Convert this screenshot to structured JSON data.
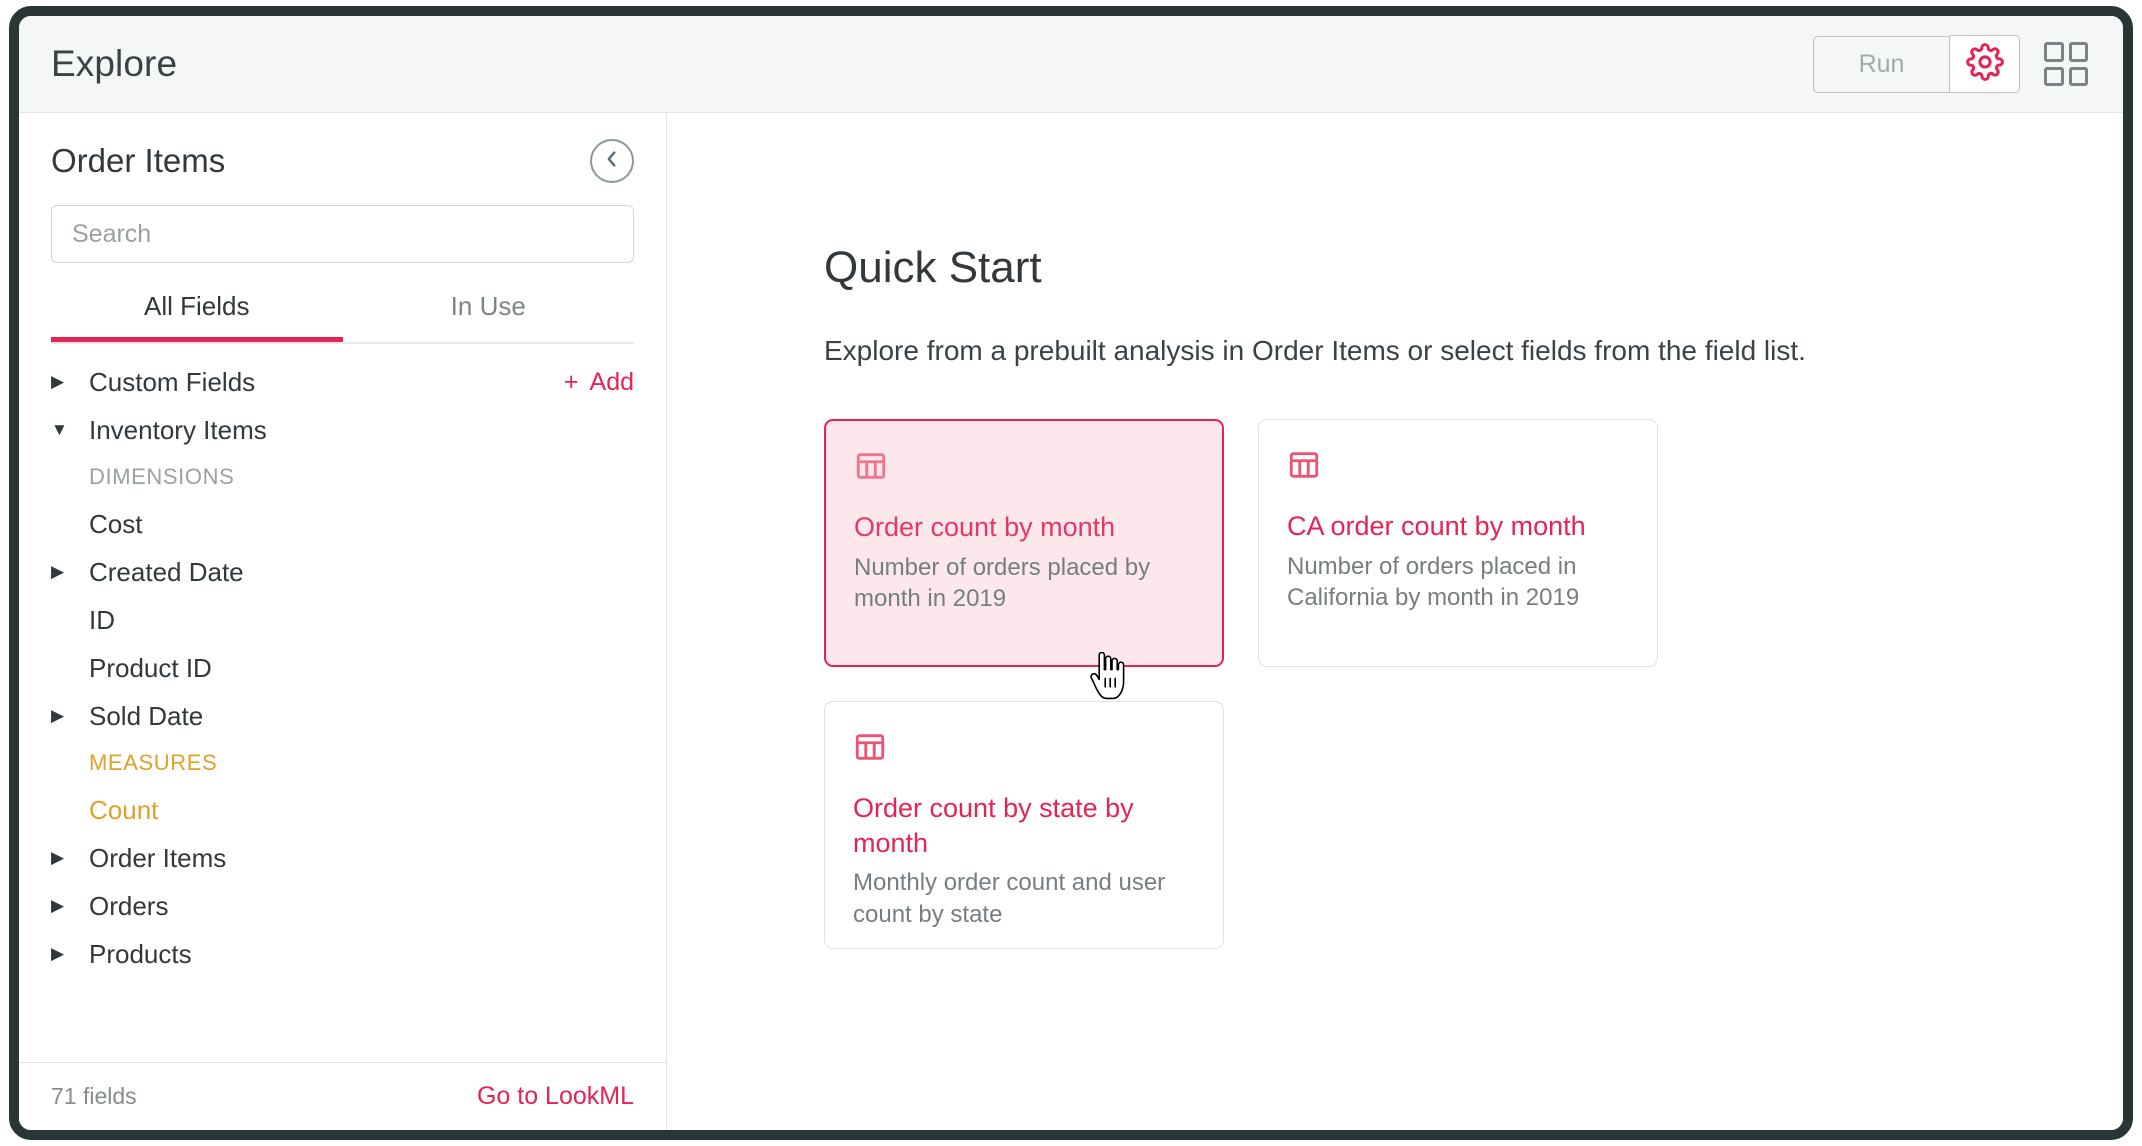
{
  "topbar": {
    "title": "Explore",
    "run_label": "Run",
    "gear_icon": "gear-icon",
    "apps_icon": "apps-grid-icon"
  },
  "sidebar": {
    "title": "Order Items",
    "collapse_icon": "chevron-left-icon",
    "search": {
      "value": "",
      "placeholder": "Search"
    },
    "tabs": [
      {
        "label": "All Fields",
        "active": true
      },
      {
        "label": "In Use",
        "active": false
      }
    ],
    "tree": [
      {
        "label": "Custom Fields",
        "type": "group",
        "expanded": false,
        "action": "Add"
      },
      {
        "label": "Inventory Items",
        "type": "group",
        "expanded": true
      },
      {
        "label": "DIMENSIONS",
        "type": "section"
      },
      {
        "label": "Cost",
        "type": "field",
        "caret": false
      },
      {
        "label": "Created Date",
        "type": "field",
        "caret": true
      },
      {
        "label": "ID",
        "type": "field",
        "caret": false
      },
      {
        "label": "Product ID",
        "type": "field",
        "caret": false
      },
      {
        "label": "Sold Date",
        "type": "field",
        "caret": true
      },
      {
        "label": "MEASURES",
        "type": "section-measure"
      },
      {
        "label": "Count",
        "type": "measure",
        "caret": false
      },
      {
        "label": "Order Items",
        "type": "group",
        "expanded": false
      },
      {
        "label": "Orders",
        "type": "group",
        "expanded": false
      },
      {
        "label": "Products",
        "type": "group",
        "expanded": false
      }
    ],
    "add_label": "Add",
    "footer": {
      "field_count": "71 fields",
      "lookml_link": "Go to LookML"
    }
  },
  "main": {
    "heading": "Quick Start",
    "subheading": "Explore from a prebuilt analysis in Order Items or select fields from the field list.",
    "cards": [
      {
        "icon": "table-icon",
        "title": "Order count by month",
        "description": "Number of orders placed by month in 2019",
        "hovered": true
      },
      {
        "icon": "table-icon",
        "title": "CA order count by month",
        "description": "Number of orders placed in California by month in 2019",
        "hovered": false
      },
      {
        "icon": "table-icon",
        "title": "Order count by state by month",
        "description": "Monthly order count and user count by state",
        "hovered": false
      }
    ]
  },
  "colors": {
    "accent": "#e52354",
    "measure": "#e0a02a",
    "text": "#32383b",
    "muted": "#868d91",
    "hover_bg": "#fce7ec",
    "frame": "#2a3538"
  }
}
